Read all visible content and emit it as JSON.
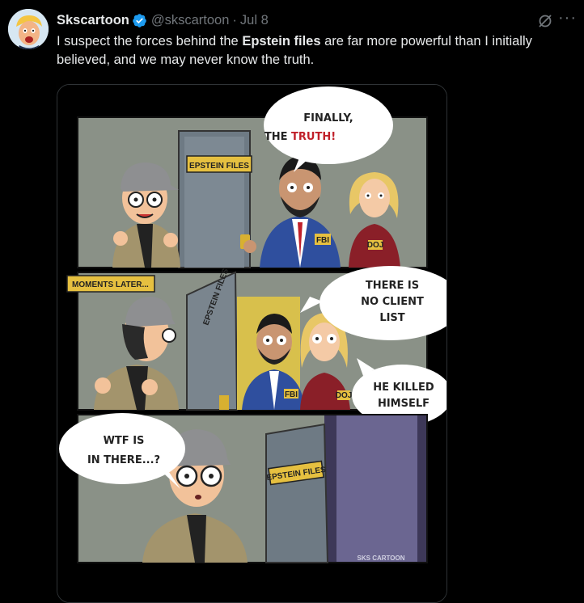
{
  "author": {
    "name": "Skscartoon",
    "handle": "@skscartoon",
    "separator": "·",
    "date": "Jul 8"
  },
  "tweet": {
    "text_part1": "I suspect the forces behind the ",
    "text_bold": "Epstein files",
    "text_part2": " are far more powerful than I initially believed, and we may never know the truth."
  },
  "comic": {
    "panel1": {
      "bubble_line1": "FINALLY,",
      "bubble_line2a": "THE ",
      "bubble_line2b": "TRUTH!",
      "door_sign": "EPSTEIN FILES",
      "badge_fbi": "FBI",
      "badge_doj": "DOJ"
    },
    "panel2": {
      "caption": "MOMENTS LATER...",
      "door_sign": "EPSTEIN FILES",
      "bubble1_line1": "THERE IS",
      "bubble1_line2": "NO CLIENT",
      "bubble1_line3": "LIST",
      "bubble2_line1": "HE KILLED",
      "bubble2_line2": "HIMSELF",
      "badge_fbi": "FBI",
      "badge_doj": "DOJ"
    },
    "panel3": {
      "bubble_line1": "WTF IS",
      "bubble_line2": "IN THERE...?",
      "door_sign": "EPSTEIN FILES",
      "watermark": "SKS CARTOON"
    }
  },
  "colors": {
    "background": "#000000",
    "text": "#e7e9ea",
    "muted": "#71767b",
    "verified": "#1d9bf0",
    "accent_red": "#c0202a"
  },
  "icons": [
    "verified-badge-icon",
    "grok-icon",
    "more-icon"
  ]
}
